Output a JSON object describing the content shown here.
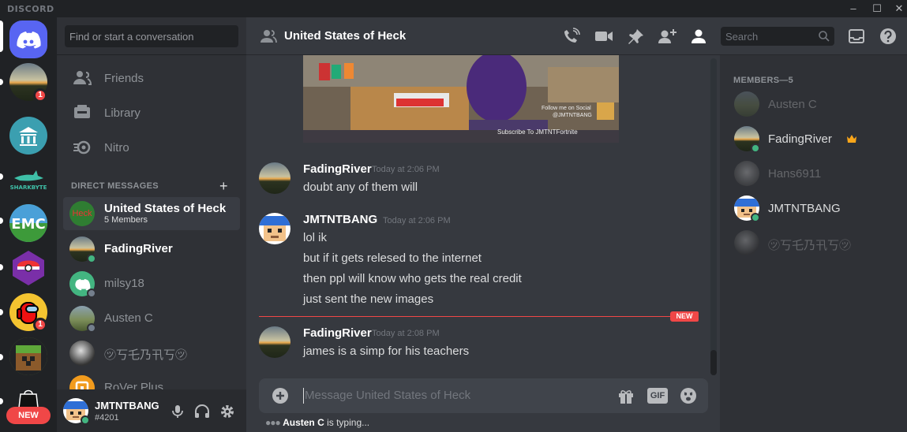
{
  "app": {
    "brand": "DISCORD",
    "window_controls": [
      "–",
      "☐",
      "✕"
    ]
  },
  "servers": {
    "badges": [
      "1",
      "1"
    ],
    "new_label": "NEW"
  },
  "dm_sidebar": {
    "search_placeholder": "Find or start a conversation",
    "nav": [
      {
        "label": "Friends",
        "icon": "friends-icon"
      },
      {
        "label": "Library",
        "icon": "library-icon"
      },
      {
        "label": "Nitro",
        "icon": "nitro-icon"
      }
    ],
    "section_title": "DIRECT MESSAGES",
    "add_label": "+",
    "dms": [
      {
        "name": "United States of Heck",
        "sub": "5 Members",
        "avatar_text": "Heck",
        "active": true
      },
      {
        "name": "FadingRiver",
        "status": "online"
      },
      {
        "name": "milsy18",
        "status": "offline"
      },
      {
        "name": "Austen C",
        "status": "offline"
      },
      {
        "name": "㋡丂乇乃卂丂㋡",
        "status": "none"
      },
      {
        "name": "RoVer Plus",
        "status": "none"
      }
    ]
  },
  "user_panel": {
    "username": "JMTNTBANG",
    "tag": "#4201"
  },
  "header": {
    "title": "United States of Heck",
    "search_placeholder": "Search"
  },
  "chat": {
    "image_caption_1": "Follow me on Social",
    "image_caption_2": "@JMTNTBANG",
    "image_caption_3": "Subscribe To JMTNTFortnite",
    "messages": [
      {
        "author": "FadingRiver",
        "time": "Today at 2:06 PM",
        "lines": [
          "doubt any of them will"
        ]
      },
      {
        "author": "JMTNTBANG",
        "time": "Today at 2:06 PM",
        "lines": [
          "lol ik",
          "but if it gets relesed to the internet",
          "then ppl will know who gets the real credit",
          "just sent the new images"
        ]
      },
      {
        "author": "FadingRiver",
        "time": "Today at 2:08 PM",
        "lines": [
          "james is a simp for his teachers"
        ]
      }
    ],
    "new_divider": "NEW",
    "composer_placeholder": "Message United States of Heck",
    "gif_label": "GIF",
    "typing_user": "Austen C",
    "typing_suffix": " is typing..."
  },
  "members": {
    "heading": "MEMBERS—5",
    "list": [
      {
        "name": "Austen C",
        "online": false
      },
      {
        "name": "FadingRiver",
        "online": true,
        "owner": true
      },
      {
        "name": "Hans6911",
        "online": false
      },
      {
        "name": "JMTNTBANG",
        "online": true
      },
      {
        "name": "㋡丂乇乃卂丂㋡",
        "online": false
      }
    ]
  },
  "colors": {
    "blurple": "#5865f2",
    "online": "#43b581",
    "danger": "#f04747",
    "crown": "#faa61a"
  }
}
